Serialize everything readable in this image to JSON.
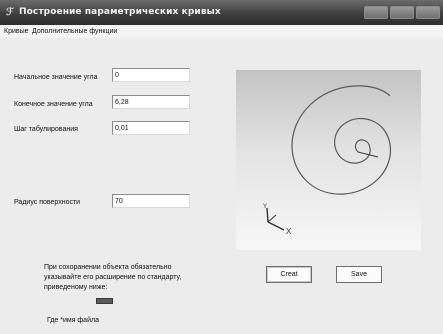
{
  "window": {
    "title": "Построение параметрических кривых",
    "icon": "app-icon"
  },
  "menu": {
    "items": [
      "Кривые",
      "Дополнительные функции"
    ]
  },
  "form": {
    "start_label": "Начальное значение угла",
    "start_value": "0",
    "end_label": "Конечное значение угла",
    "end_value": "6,28",
    "step_label": "Шаг табулирования",
    "step_value": "0,01",
    "radius_label": "Радиус поверхности",
    "radius_value": "70"
  },
  "viewport": {
    "axis_x_label": "X",
    "axis_y_label": "Y",
    "curve_color": "#5a5a5a"
  },
  "buttons": {
    "create_label": "Creat",
    "save_label": "Save"
  },
  "note": {
    "text": "При сохоранении объекта обязательно указывайте его расширение по стандарту, приведеному ниже:",
    "filename_label": "Где *имя файла"
  }
}
